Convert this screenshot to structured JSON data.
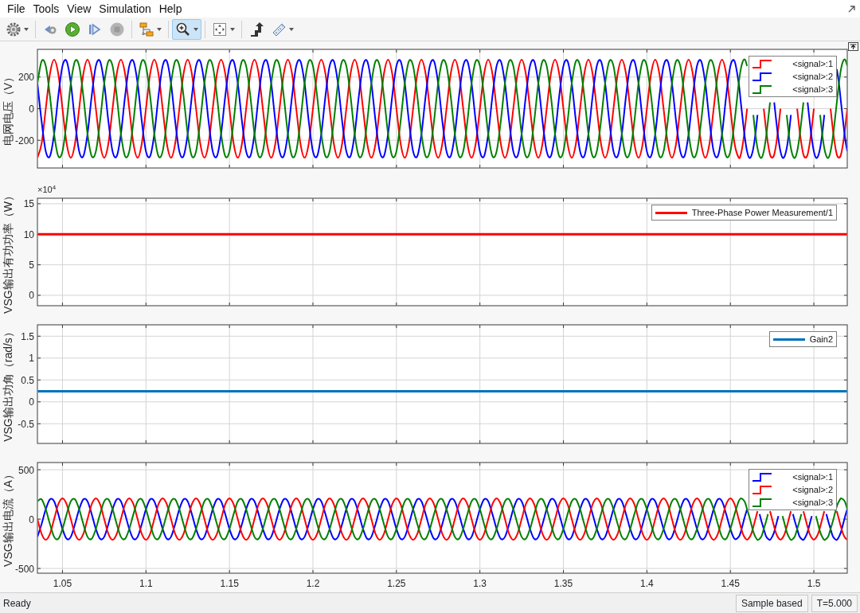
{
  "menu": [
    "File",
    "Tools",
    "View",
    "Simulation",
    "Help"
  ],
  "toolbar": [
    {
      "buttons": [
        {
          "selected": false,
          "disabled": false,
          "dropdown": true
        }
      ]
    },
    {
      "buttons": [
        {
          "selected": false,
          "disabled": false,
          "dropdown": false
        },
        {
          "selected": false,
          "disabled": false,
          "dropdown": false
        },
        {
          "selected": false,
          "disabled": false,
          "dropdown": false
        },
        {
          "selected": false,
          "disabled": true,
          "dropdown": false
        }
      ]
    },
    {
      "buttons": [
        {
          "selected": false,
          "disabled": false,
          "dropdown": true
        }
      ]
    },
    {
      "buttons": [
        {
          "selected": true,
          "disabled": false,
          "dropdown": true
        }
      ]
    },
    {
      "buttons": [
        {
          "selected": false,
          "disabled": false,
          "dropdown": true
        }
      ]
    },
    {
      "buttons": [
        {
          "selected": false,
          "disabled": false,
          "dropdown": false
        },
        {
          "selected": false,
          "disabled": false,
          "dropdown": true
        }
      ]
    }
  ],
  "plots": [
    {
      "kind": "step",
      "chart_data": {
        "type": "line",
        "grid": true,
        "legend": "upper right",
        "ylabel": "电网电压（V）",
        "xlim": [
          1.035,
          1.52
        ],
        "ylim": [
          -375,
          375
        ],
        "yticks": [
          {
            "value": -200,
            "label": "-200"
          },
          {
            "value": 0,
            "label": "0"
          },
          {
            "value": 200,
            "label": "200"
          }
        ],
        "x": [
          1.035,
          1.0375,
          1.04,
          1.0425,
          1.045,
          1.0475,
          1.05,
          1.0525,
          1.055,
          1.0575,
          1.06,
          1.0625,
          1.065,
          1.0675,
          1.07,
          1.0725,
          1.075,
          1.0775,
          1.08,
          1.0825,
          1.085,
          1.0875,
          1.09,
          1.0925,
          1.095,
          1.0975,
          1.1,
          1.1025,
          1.105,
          1.1075,
          1.11,
          1.1125,
          1.115,
          1.1175,
          1.12,
          1.1225,
          1.125,
          1.1275,
          1.13,
          1.1325,
          1.135,
          1.1375,
          1.14,
          1.1425,
          1.145,
          1.1475,
          1.15,
          1.1525,
          1.155,
          1.1575,
          1.16,
          1.1625,
          1.165,
          1.1675,
          1.17,
          1.1725,
          1.175,
          1.1775,
          1.18,
          1.1825,
          1.185,
          1.1875,
          1.19,
          1.1925,
          1.195,
          1.1975,
          1.2,
          1.2025,
          1.205,
          1.2075,
          1.21,
          1.2125,
          1.215,
          1.2175,
          1.22,
          1.2225,
          1.225,
          1.2275,
          1.23,
          1.2325,
          1.235,
          1.2375,
          1.24,
          1.2425,
          1.245,
          1.2475,
          1.25,
          1.2525,
          1.255,
          1.2575,
          1.26,
          1.2625,
          1.265,
          1.2675,
          1.27,
          1.2725,
          1.275,
          1.2775,
          1.28,
          1.2825,
          1.285,
          1.2875,
          1.29,
          1.2925,
          1.295,
          1.2975,
          1.3,
          1.3025,
          1.305,
          1.3075,
          1.31,
          1.3125,
          1.315,
          1.3175,
          1.32,
          1.3225,
          1.325,
          1.3275,
          1.33,
          1.3325,
          1.335,
          1.3375,
          1.34,
          1.3425,
          1.345,
          1.3475,
          1.35,
          1.3525,
          1.355,
          1.3575,
          1.36,
          1.3625,
          1.365,
          1.3675,
          1.37,
          1.3725,
          1.375,
          1.3775,
          1.38,
          1.3825,
          1.385,
          1.3875,
          1.39,
          1.3925,
          1.395,
          1.3975,
          1.4,
          1.4025,
          1.405,
          1.4075,
          1.41,
          1.4125,
          1.415,
          1.4175,
          1.42,
          1.4225,
          1.425,
          1.4275,
          1.43,
          1.4325,
          1.435,
          1.4375,
          1.44,
          1.4425,
          1.445,
          1.4475,
          1.45,
          1.4525,
          1.455,
          1.45625,
          1.4575,
          1.45875,
          1.46,
          1.46125,
          1.4625,
          1.46375,
          1.465,
          1.46625,
          1.4675,
          1.46875,
          1.47,
          1.47125,
          1.4725,
          1.47375,
          1.475,
          1.47625,
          1.4775,
          1.47875,
          1.48,
          1.48125,
          1.4825,
          1.48375,
          1.485,
          1.48625,
          1.4875,
          1.48875,
          1.49,
          1.49125,
          1.4925,
          1.49375,
          1.495,
          1.49625,
          1.4975,
          1.49875,
          1.5,
          1.50125,
          1.5025,
          1.50375,
          1.505,
          1.50625,
          1.5075,
          1.50875,
          1.51,
          1.51125,
          1.5125,
          1.51375,
          1.515,
          1.51625,
          1.5175,
          1.51875,
          1.52
        ],
        "series": [
          {
            "name": "<signal>:1",
            "color": "#ff0000",
            "values": [
              -310,
              -220,
              0,
              220,
              310,
              220,
              0,
              -220,
              -310,
              -220,
              0,
              220,
              310,
              220,
              0,
              -220,
              -310,
              -220,
              0,
              220,
              310,
              220,
              0,
              -220,
              -310,
              -220,
              0,
              220,
              310,
              220,
              0,
              -220,
              -310,
              -220,
              0,
              220,
              310,
              220,
              0,
              -220,
              -310,
              -220,
              0,
              220,
              310,
              220,
              0,
              -220,
              -310,
              -220,
              0,
              220,
              310,
              220,
              0,
              -220,
              -310,
              -220,
              0,
              220,
              310,
              220,
              0,
              -220,
              -310,
              -220,
              0,
              220,
              310,
              220,
              0,
              -220,
              -310,
              -220,
              0,
              220,
              310,
              220,
              0,
              -220,
              -310,
              -220,
              0,
              220,
              310,
              220,
              0,
              -220,
              -310,
              -220,
              0,
              220,
              310,
              220,
              0,
              -220,
              -310,
              -220,
              0,
              220,
              310,
              220,
              0,
              -220,
              -310,
              -220,
              0,
              220,
              310,
              220,
              0,
              -220,
              -310,
              -220,
              0,
              220,
              310,
              220,
              0,
              -220,
              -310,
              -220,
              0,
              220,
              310,
              220,
              0,
              -220,
              -310,
              -220,
              0,
              220,
              310,
              220,
              0,
              -220,
              -310,
              -220,
              0,
              220,
              310,
              220,
              0,
              -220,
              -310,
              -220,
              0,
              220,
              310,
              220,
              0,
              -220,
              -310,
              -220,
              0,
              220,
              310,
              220,
              0,
              -220,
              -310,
              -220,
              0,
              220,
              310,
              220,
              0,
              -220,
              -310,
              -290,
              -220,
              -120,
              0,
              null,
              null,
              null,
              null,
              null,
              null,
              null,
              0,
              -120,
              -220,
              -290,
              -310,
              -290,
              -220,
              -120,
              0,
              null,
              null,
              null,
              null,
              null,
              null,
              null,
              0,
              -120,
              -220,
              -290,
              -310,
              -290,
              -220,
              -120,
              0,
              null,
              null,
              null,
              null,
              null,
              null,
              null,
              0,
              -120,
              -220,
              -290,
              -310,
              -290,
              -220,
              -120,
              0
            ]
          },
          {
            "name": "<signal>:2",
            "color": "#0000ff",
            "values": [
              160,
              -80,
              -270,
              -300,
              -160,
              80,
              270,
              300,
              160,
              -80,
              -270,
              -300,
              -160,
              80,
              270,
              300,
              160,
              -80,
              -270,
              -300,
              -160,
              80,
              270,
              300,
              160,
              -80,
              -270,
              -300,
              -160,
              80,
              270,
              300,
              160,
              -80,
              -270,
              -300,
              -160,
              80,
              270,
              300,
              160,
              -80,
              -270,
              -300,
              -160,
              80,
              270,
              300,
              160,
              -80,
              -270,
              -300,
              -160,
              80,
              270,
              300,
              160,
              -80,
              -270,
              -300,
              -160,
              80,
              270,
              300,
              160,
              -80,
              -270,
              -300,
              -160,
              80,
              270,
              300,
              160,
              -80,
              -270,
              -300,
              -160,
              80,
              270,
              300,
              160,
              -80,
              -270,
              -300,
              -160,
              80,
              270,
              300,
              160,
              -80,
              -270,
              -300,
              -160,
              80,
              270,
              300,
              160,
              -80,
              -270,
              -300,
              -160,
              80,
              270,
              300,
              160,
              -80,
              -270,
              -300,
              -160,
              80,
              270,
              300,
              160,
              -80,
              -270,
              -300,
              -160,
              80,
              270,
              300,
              160,
              -80,
              -270,
              -300,
              -160,
              80,
              270,
              300,
              160,
              -80,
              -270,
              -300,
              -160,
              80,
              270,
              300,
              160,
              -80,
              -270,
              -300,
              -160,
              80,
              270,
              300,
              160,
              -80,
              -270,
              -300,
              -160,
              80,
              270,
              300,
              160,
              -80,
              -270,
              -300,
              -160,
              80,
              270,
              300,
              160,
              -80,
              -270,
              -300,
              -160,
              80,
              270,
              300,
              160,
              40,
              -80,
              -190,
              -270,
              -310,
              -300,
              -250,
              -160,
              -40,
              null,
              null,
              null,
              null,
              null,
              null,
              null,
              40,
              -80,
              -190,
              -270,
              -310,
              -300,
              -250,
              -160,
              -40,
              null,
              null,
              null,
              null,
              null,
              null,
              null,
              40,
              -80,
              -190,
              -270,
              -310,
              -300,
              -250,
              -160,
              -40,
              null,
              null,
              null,
              null,
              null,
              250,
              160,
              40,
              -80,
              -190,
              -270
            ]
          },
          {
            "name": "<signal>:3",
            "color": "#008000",
            "values": [
              160,
              300,
              270,
              80,
              -160,
              -300,
              -270,
              -80,
              160,
              300,
              270,
              80,
              -160,
              -300,
              -270,
              -80,
              160,
              300,
              270,
              80,
              -160,
              -300,
              -270,
              -80,
              160,
              300,
              270,
              80,
              -160,
              -300,
              -270,
              -80,
              160,
              300,
              270,
              80,
              -160,
              -300,
              -270,
              -80,
              160,
              300,
              270,
              80,
              -160,
              -300,
              -270,
              -80,
              160,
              300,
              270,
              80,
              -160,
              -300,
              -270,
              -80,
              160,
              300,
              270,
              80,
              -160,
              -300,
              -270,
              -80,
              160,
              300,
              270,
              80,
              -160,
              -300,
              -270,
              -80,
              160,
              300,
              270,
              80,
              -160,
              -300,
              -270,
              -80,
              160,
              300,
              270,
              80,
              -160,
              -300,
              -270,
              -80,
              160,
              300,
              270,
              80,
              -160,
              -300,
              -270,
              -80,
              160,
              300,
              270,
              80,
              -160,
              -300,
              -270,
              -80,
              160,
              300,
              270,
              80,
              -160,
              -300,
              -270,
              -80,
              160,
              300,
              270,
              80,
              -160,
              -300,
              -270,
              -80,
              160,
              300,
              270,
              80,
              -160,
              -300,
              -270,
              -80,
              160,
              300,
              270,
              80,
              -160,
              -300,
              -270,
              -80,
              160,
              300,
              270,
              80,
              -160,
              -300,
              -270,
              -80,
              160,
              300,
              270,
              80,
              -160,
              -300,
              -270,
              -80,
              160,
              300,
              270,
              80,
              -160,
              -300,
              -270,
              -80,
              160,
              300,
              270,
              80,
              -160,
              -300,
              -270,
              -80,
              160,
              250,
              300,
              310,
              270,
              null,
              null,
              -40,
              -160,
              -250,
              -300,
              -310,
              -270,
              -190,
              -80,
              40,
              null,
              null,
              null,
              null,
              null,
              null,
              null,
              -40,
              -160,
              -250,
              -300,
              -310,
              -270,
              -190,
              -80,
              40,
              null,
              null,
              null,
              null,
              null,
              null,
              null,
              -40,
              -160,
              -250,
              -300,
              -310,
              -270,
              -190,
              -80,
              40,
              160,
              250,
              300,
              310,
              270
            ]
          }
        ]
      }
    },
    {
      "kind": "line",
      "exponent_label": "×10$^{4}$",
      "chart_data": {
        "type": "line",
        "grid": true,
        "legend": "upper right",
        "ylabel": "VSG输出有功功率（W）",
        "xlim": [
          1.035,
          1.52
        ],
        "ylim": [
          -1.7,
          15.9
        ],
        "yticks": [
          {
            "value": 0,
            "label": "0"
          },
          {
            "value": 5,
            "label": "5"
          },
          {
            "value": 10,
            "label": "10"
          },
          {
            "value": 15,
            "label": "15"
          }
        ],
        "x": [
          1.035,
          1.52
        ],
        "series": [
          {
            "name": "Three-Phase Power Measurement/1",
            "color": "#ff0000",
            "values": [
              10,
              10
            ]
          }
        ]
      }
    },
    {
      "kind": "line",
      "chart_data": {
        "type": "line",
        "grid": true,
        "legend": "upper right",
        "ylabel": "VSG输出功角（rad/s）",
        "xlim": [
          1.035,
          1.52
        ],
        "ylim": [
          -0.95,
          1.76
        ],
        "yticks": [
          {
            "value": -0.5,
            "label": "-0.5"
          },
          {
            "value": 0,
            "label": "0"
          },
          {
            "value": 0.5,
            "label": "0.5"
          },
          {
            "value": 1,
            "label": "1"
          },
          {
            "value": 1.5,
            "label": "1.5"
          }
        ],
        "x": [
          1.035,
          1.52
        ],
        "series": [
          {
            "name": "Gain2",
            "color": "#0072bd",
            "values": [
              0.24,
              0.24
            ]
          }
        ]
      }
    },
    {
      "kind": "step",
      "chart_data": {
        "type": "line",
        "grid": true,
        "legend": "upper right",
        "ylabel": "VSG输出电流（A）",
        "xlim": [
          1.035,
          1.52
        ],
        "ylim": [
          -548,
          573
        ],
        "xticks": [
          {
            "value": 1.05,
            "label": "1.05"
          },
          {
            "value": 1.1,
            "label": "1.1"
          },
          {
            "value": 1.15,
            "label": "1.15"
          },
          {
            "value": 1.2,
            "label": "1.2"
          },
          {
            "value": 1.25,
            "label": "1.25"
          },
          {
            "value": 1.3,
            "label": "1.3"
          },
          {
            "value": 1.35,
            "label": "1.35"
          },
          {
            "value": 1.4,
            "label": "1.4"
          },
          {
            "value": 1.45,
            "label": "1.45"
          },
          {
            "value": 1.5,
            "label": "1.5"
          }
        ],
        "yticks": [
          {
            "value": -500,
            "label": "-500"
          },
          {
            "value": 0,
            "label": "0"
          },
          {
            "value": 500,
            "label": "500"
          }
        ],
        "x": [
          1.035,
          1.0375,
          1.04,
          1.0425,
          1.045,
          1.0475,
          1.05,
          1.0525,
          1.055,
          1.0575,
          1.06,
          1.0625,
          1.065,
          1.0675,
          1.07,
          1.0725,
          1.075,
          1.0775,
          1.08,
          1.0825,
          1.085,
          1.0875,
          1.09,
          1.0925,
          1.095,
          1.0975,
          1.1,
          1.1025,
          1.105,
          1.1075,
          1.11,
          1.1125,
          1.115,
          1.1175,
          1.12,
          1.1225,
          1.125,
          1.1275,
          1.13,
          1.1325,
          1.135,
          1.1375,
          1.14,
          1.1425,
          1.145,
          1.1475,
          1.15,
          1.1525,
          1.155,
          1.1575,
          1.16,
          1.1625,
          1.165,
          1.1675,
          1.17,
          1.1725,
          1.175,
          1.1775,
          1.18,
          1.1825,
          1.185,
          1.1875,
          1.19,
          1.1925,
          1.195,
          1.1975,
          1.2,
          1.2025,
          1.205,
          1.2075,
          1.21,
          1.2125,
          1.215,
          1.2175,
          1.22,
          1.2225,
          1.225,
          1.2275,
          1.23,
          1.2325,
          1.235,
          1.2375,
          1.24,
          1.2425,
          1.245,
          1.2475,
          1.25,
          1.2525,
          1.255,
          1.2575,
          1.26,
          1.2625,
          1.265,
          1.2675,
          1.27,
          1.2725,
          1.275,
          1.2775,
          1.28,
          1.2825,
          1.285,
          1.2875,
          1.29,
          1.2925,
          1.295,
          1.2975,
          1.3,
          1.3025,
          1.305,
          1.3075,
          1.31,
          1.3125,
          1.315,
          1.3175,
          1.32,
          1.3225,
          1.325,
          1.3275,
          1.33,
          1.3325,
          1.335,
          1.3375,
          1.34,
          1.3425,
          1.345,
          1.3475,
          1.35,
          1.3525,
          1.355,
          1.3575,
          1.36,
          1.3625,
          1.365,
          1.3675,
          1.37,
          1.3725,
          1.375,
          1.3775,
          1.38,
          1.3825,
          1.385,
          1.3875,
          1.39,
          1.3925,
          1.395,
          1.3975,
          1.4,
          1.4025,
          1.405,
          1.4075,
          1.41,
          1.4125,
          1.415,
          1.4175,
          1.42,
          1.4225,
          1.425,
          1.4275,
          1.43,
          1.4325,
          1.435,
          1.4375,
          1.44,
          1.4425,
          1.445,
          1.4475,
          1.45,
          1.4525,
          1.455,
          1.45625,
          1.4575,
          1.45875,
          1.46,
          1.46125,
          1.4625,
          1.46375,
          1.465,
          1.46625,
          1.4675,
          1.46875,
          1.47,
          1.47125,
          1.4725,
          1.47375,
          1.475,
          1.47625,
          1.4775,
          1.47875,
          1.48,
          1.48125,
          1.4825,
          1.48375,
          1.485,
          1.48625,
          1.4875,
          1.48875,
          1.49,
          1.49125,
          1.4925,
          1.49375,
          1.495,
          1.49625,
          1.4975,
          1.49875,
          1.5,
          1.50125,
          1.5025,
          1.50375,
          1.505,
          1.50625,
          1.5075,
          1.50875,
          1.51,
          1.51125,
          1.5125,
          1.51375,
          1.515,
          1.51625,
          1.5175,
          1.51875,
          1.52
        ],
        "series": [
          {
            "name": "<signal>:1",
            "color": "#0000ff",
            "values": [
              -180,
              -50,
              100,
              200,
              180,
              50,
              -100,
              -200,
              -180,
              -50,
              100,
              200,
              180,
              50,
              -100,
              -200,
              -180,
              -50,
              100,
              200,
              180,
              50,
              -100,
              -200,
              -180,
              -50,
              100,
              200,
              180,
              50,
              -100,
              -200,
              -180,
              -50,
              100,
              200,
              180,
              50,
              -100,
              -200,
              -180,
              -50,
              100,
              200,
              180,
              50,
              -100,
              -200,
              -180,
              -50,
              100,
              200,
              180,
              50,
              -100,
              -200,
              -180,
              -50,
              100,
              200,
              180,
              50,
              -100,
              -200,
              -180,
              -50,
              100,
              200,
              180,
              50,
              -100,
              -200,
              -180,
              -50,
              100,
              200,
              180,
              50,
              -100,
              -200,
              -180,
              -50,
              100,
              200,
              180,
              50,
              -100,
              -200,
              -180,
              -50,
              100,
              200,
              180,
              50,
              -100,
              -200,
              -180,
              -50,
              100,
              200,
              180,
              50,
              -100,
              -200,
              -180,
              -50,
              100,
              200,
              180,
              50,
              -100,
              -200,
              -180,
              -50,
              100,
              200,
              180,
              50,
              -100,
              -200,
              -180,
              -50,
              100,
              200,
              180,
              50,
              -100,
              -200,
              -180,
              -50,
              100,
              200,
              180,
              50,
              -100,
              -200,
              -180,
              -50,
              100,
              200,
              180,
              50,
              -100,
              -200,
              -180,
              -50,
              100,
              200,
              180,
              50,
              -100,
              -200,
              -180,
              -50,
              100,
              200,
              180,
              50,
              -100,
              -200,
              -180,
              -50,
              100,
              200,
              180,
              50,
              -100,
              -200,
              -180,
              -130,
              -50,
              30,
              100,
              null,
              null,
              null,
              null,
              null,
              50,
              -30,
              -100,
              -170,
              -200,
              -210,
              -180,
              -130,
              -50,
              30,
              null,
              null,
              null,
              null,
              null,
              null,
              50,
              -30,
              -100,
              -170,
              -200,
              -210,
              -180,
              -130,
              -50,
              30,
              null,
              null,
              null,
              null,
              null,
              null,
              50,
              -30,
              -100,
              -170,
              -200,
              -210,
              -180,
              -130,
              -50,
              30,
              100
            ]
          },
          {
            "name": "<signal>:2",
            "color": "#ff0000",
            "values": [
              0,
              -150,
              -210,
              -150,
              0,
              150,
              210,
              150,
              0,
              -150,
              -210,
              -150,
              0,
              150,
              210,
              150,
              0,
              -150,
              -210,
              -150,
              0,
              150,
              210,
              150,
              0,
              -150,
              -210,
              -150,
              0,
              150,
              210,
              150,
              0,
              -150,
              -210,
              -150,
              0,
              150,
              210,
              150,
              0,
              -150,
              -210,
              -150,
              0,
              150,
              210,
              150,
              0,
              -150,
              -210,
              -150,
              0,
              150,
              210,
              150,
              0,
              -150,
              -210,
              -150,
              0,
              150,
              210,
              150,
              0,
              -150,
              -210,
              -150,
              0,
              150,
              210,
              150,
              0,
              -150,
              -210,
              -150,
              0,
              150,
              210,
              150,
              0,
              -150,
              -210,
              -150,
              0,
              150,
              210,
              150,
              0,
              -150,
              -210,
              -150,
              0,
              150,
              210,
              150,
              0,
              -150,
              -210,
              -150,
              0,
              150,
              210,
              150,
              0,
              -150,
              -210,
              -150,
              0,
              150,
              210,
              150,
              0,
              -150,
              -210,
              -150,
              0,
              150,
              210,
              150,
              0,
              -150,
              -210,
              -150,
              0,
              150,
              210,
              150,
              0,
              -150,
              -210,
              -150,
              0,
              150,
              210,
              150,
              0,
              -150,
              -210,
              -150,
              0,
              150,
              210,
              150,
              0,
              -150,
              -210,
              -150,
              0,
              150,
              210,
              150,
              0,
              -150,
              -210,
              -150,
              0,
              150,
              210,
              150,
              0,
              -150,
              -210,
              -150,
              0,
              150,
              210,
              150,
              0,
              -80,
              -150,
              -190,
              -210,
              -190,
              -150,
              -80,
              0,
              80,
              null,
              null,
              null,
              null,
              null,
              80,
              0,
              -80,
              -150,
              -190,
              -210,
              -190,
              -150,
              -80,
              0,
              80,
              null,
              null,
              null,
              null,
              null,
              80,
              0,
              -80,
              -150,
              -190,
              -210,
              -190,
              -150,
              -80,
              0,
              80,
              null,
              null,
              null,
              null,
              null,
              80,
              0,
              -80,
              -150,
              -190,
              -210
            ]
          },
          {
            "name": "<signal>:3",
            "color": "#008000",
            "values": [
              180,
              200,
              100,
              -50,
              -180,
              -200,
              -100,
              50,
              180,
              200,
              100,
              -50,
              -180,
              -200,
              -100,
              50,
              180,
              200,
              100,
              -50,
              -180,
              -200,
              -100,
              50,
              180,
              200,
              100,
              -50,
              -180,
              -200,
              -100,
              50,
              180,
              200,
              100,
              -50,
              -180,
              -200,
              -100,
              50,
              180,
              200,
              100,
              -50,
              -180,
              -200,
              -100,
              50,
              180,
              200,
              100,
              -50,
              -180,
              -200,
              -100,
              50,
              180,
              200,
              100,
              -50,
              -180,
              -200,
              -100,
              50,
              180,
              200,
              100,
              -50,
              -180,
              -200,
              -100,
              50,
              180,
              200,
              100,
              -50,
              -180,
              -200,
              -100,
              50,
              180,
              200,
              100,
              -50,
              -180,
              -200,
              -100,
              50,
              180,
              200,
              100,
              -50,
              -180,
              -200,
              -100,
              50,
              180,
              200,
              100,
              -50,
              -180,
              -200,
              -100,
              50,
              180,
              200,
              100,
              -50,
              -180,
              -200,
              -100,
              50,
              180,
              200,
              100,
              -50,
              -180,
              -200,
              -100,
              50,
              180,
              200,
              100,
              -50,
              -180,
              -200,
              -100,
              50,
              180,
              200,
              100,
              -50,
              -180,
              -200,
              -100,
              50,
              180,
              200,
              100,
              -50,
              -180,
              -200,
              -100,
              50,
              180,
              200,
              100,
              -50,
              -180,
              -200,
              -100,
              50,
              180,
              200,
              100,
              -50,
              -180,
              -200,
              -100,
              50,
              180,
              200,
              100,
              -50,
              -180,
              -200,
              -100,
              50,
              180,
              210,
              200,
              170,
              100,
              30,
              -50,
              -130,
              -180,
              -210,
              -200,
              -170,
              -100,
              -30,
              50,
              null,
              null,
              null,
              null,
              null,
              null,
              30,
              -50,
              -130,
              -180,
              -210,
              -200,
              -170,
              -100,
              -30,
              50,
              null,
              null,
              null,
              null,
              null,
              null,
              30,
              -50,
              -130,
              -180,
              -210,
              -200,
              -170,
              -100,
              -30,
              50,
              130,
              180,
              210,
              200,
              170,
              100
            ]
          }
        ]
      }
    }
  ],
  "status_bar": {
    "text": "Ready",
    "panels": [
      "Sample based",
      "T=5.000"
    ]
  }
}
